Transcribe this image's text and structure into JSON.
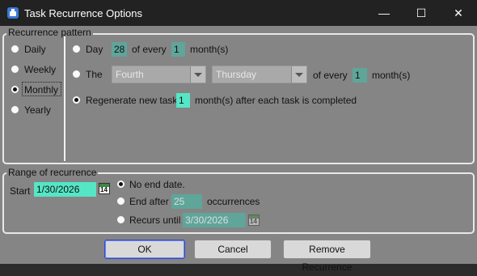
{
  "window": {
    "title": "Task Recurrence Options",
    "controls": {
      "minimize": "—",
      "maximize": "☐",
      "close": "✕"
    }
  },
  "recurrence_pattern": {
    "legend": "Recurrence pattern",
    "frequency": [
      {
        "label": "Daily",
        "selected": false
      },
      {
        "label": "Weekly",
        "selected": false
      },
      {
        "label": "Monthly",
        "selected": true
      },
      {
        "label": "Yearly",
        "selected": false
      }
    ],
    "monthly": {
      "day_option": {
        "label": "Day",
        "day_value": "28",
        "of_every_label": "of every",
        "months_value": "1",
        "months_label": "month(s)"
      },
      "the_option": {
        "label": "The",
        "ordinal_value": "Fourth",
        "weekday_value": "Thursday",
        "of_every_label": "of every",
        "months_value": "1",
        "months_label": "month(s)"
      },
      "regenerate_option": {
        "label": "Regenerate new task",
        "months_value": "1",
        "suffix": "month(s) after each task is completed",
        "selected": true
      }
    }
  },
  "range": {
    "legend": "Range of recurrence",
    "start_label": "Start",
    "start_value": "1/30/2026",
    "calendar_day": "14",
    "options": {
      "no_end": {
        "label": "No end date.",
        "selected": true
      },
      "end_after": {
        "label": "End after",
        "value": "25",
        "suffix": "occurrences"
      },
      "recurs_until": {
        "label": "Recurs until",
        "value": "3/30/2026"
      }
    }
  },
  "buttons": {
    "ok": "OK",
    "cancel": "Cancel",
    "remove": "Remove Recurrence"
  }
}
